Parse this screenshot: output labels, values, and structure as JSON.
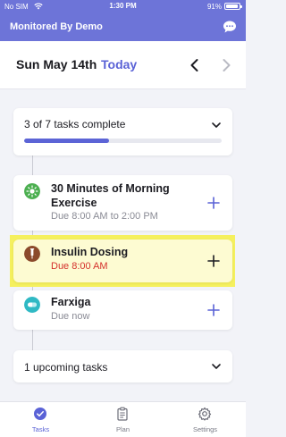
{
  "status_bar": {
    "carrier": "No SIM",
    "time": "1:30 PM",
    "battery": "91%"
  },
  "header": {
    "title": "Monitored By Demo",
    "chat_icon": "chat-bubble-icon"
  },
  "date_nav": {
    "date": "Sun May 14th",
    "today_label": "Today"
  },
  "progress": {
    "text": "3 of 7 tasks complete",
    "fraction": 0.43
  },
  "tasks": [
    {
      "name": "30 Minutes of Morning Exercise",
      "due": "Due 8:00 AM to 2:00 PM",
      "icon": "sun-icon",
      "color": "#4caf50"
    },
    {
      "name": "Insulin Dosing",
      "due": "Due 8:00 AM",
      "icon": "insulin-pen-icon",
      "color": "#8b4a2b",
      "overdue_color": "#d4312c"
    },
    {
      "name": "Farxiga",
      "due": "Due now",
      "icon": "pill-icon",
      "color": "#2fb9c4"
    }
  ],
  "upcoming": {
    "text": "1 upcoming tasks"
  },
  "tabbar": {
    "tabs": [
      {
        "label": "Tasks",
        "icon": "check-circle-icon",
        "active": true
      },
      {
        "label": "Plan",
        "icon": "clipboard-icon",
        "active": false
      },
      {
        "label": "Settings",
        "icon": "gear-icon",
        "active": false
      }
    ]
  },
  "colors": {
    "accent": "#5a62d6",
    "header": "#6d74d8",
    "highlight": "#f5f05e",
    "overdue": "#d4312c"
  }
}
